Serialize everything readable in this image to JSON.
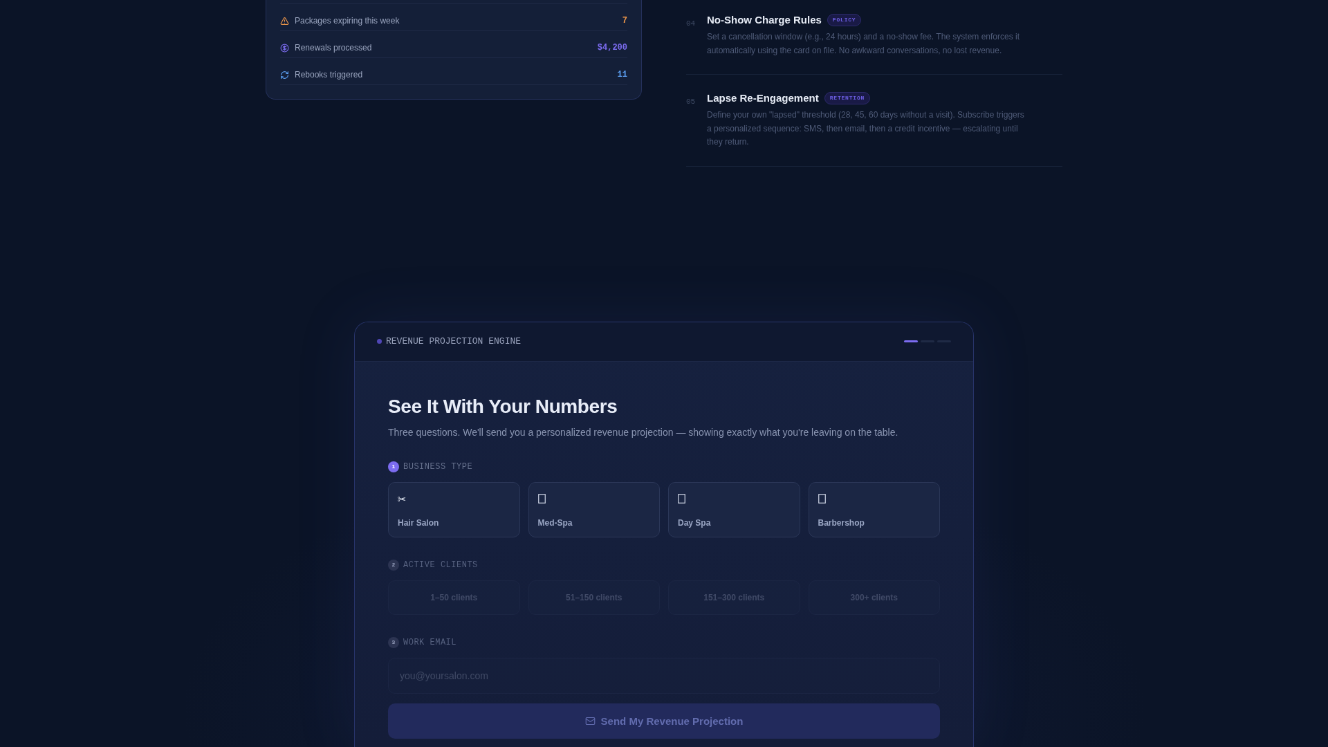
{
  "stats_card": {
    "rows": [
      {
        "kind": "alert",
        "label": "Packages expiring this week",
        "value": "7",
        "color": "#f2994a"
      },
      {
        "kind": "money",
        "label": "Renewals processed",
        "value": "$4,200",
        "color": "#7c6cf0"
      },
      {
        "kind": "refresh",
        "label": "Rebooks triggered",
        "value": "11",
        "color": "#5b9ef0"
      }
    ]
  },
  "features": [
    {
      "number": "04",
      "title": "No-Show Charge Rules",
      "tag": "POLICY",
      "description": "Set a cancellation window (e.g., 24 hours) and a no-show fee. The system enforces it automatically using the card on file. No awkward conversations, no lost revenue."
    },
    {
      "number": "05",
      "title": "Lapse Re-Engagement",
      "tag": "RETENTION",
      "description": "Define your own \"lapsed\" threshold (28, 45, 60 days without a visit). Subscribe triggers a personalized sequence: SMS, then email, then a credit incentive — escalating until they return."
    }
  ],
  "projection_form": {
    "eyebrow": "REVENUE PROJECTION ENGINE",
    "progress": [
      {
        "active": true
      },
      {
        "active": false
      },
      {
        "active": false
      }
    ],
    "title": "See It With Your Numbers",
    "subtitle": "Three questions. We'll send you a personalized revenue projection — showing exactly what you're leaving on the table.",
    "steps": [
      {
        "kind": "tiles",
        "number": "1",
        "label": "BUSINESS TYPE",
        "disabled": false,
        "options": [
          {
            "icon": "✂",
            "label": "Hair Salon",
            "selected": false
          },
          {
            "label": "Med-Spa",
            "selected": false
          },
          {
            "label": "Day Spa",
            "selected": false
          },
          {
            "label": "Barbershop",
            "selected": false
          }
        ]
      },
      {
        "kind": "chips",
        "number": "2",
        "label": "ACTIVE CLIENTS",
        "disabled": true,
        "options": [
          {
            "label": "1–50 clients",
            "selected": false
          },
          {
            "label": "51–150 clients",
            "selected": false
          },
          {
            "label": "151–300 clients",
            "selected": false
          },
          {
            "label": "300+ clients",
            "selected": false
          }
        ]
      },
      {
        "kind": "email",
        "number": "3",
        "label": "WORK EMAIL",
        "disabled": true,
        "placeholder": "you@yoursalon.com"
      }
    ],
    "submit": {
      "label": "Send My Revenue Projection",
      "disabled": true
    }
  }
}
